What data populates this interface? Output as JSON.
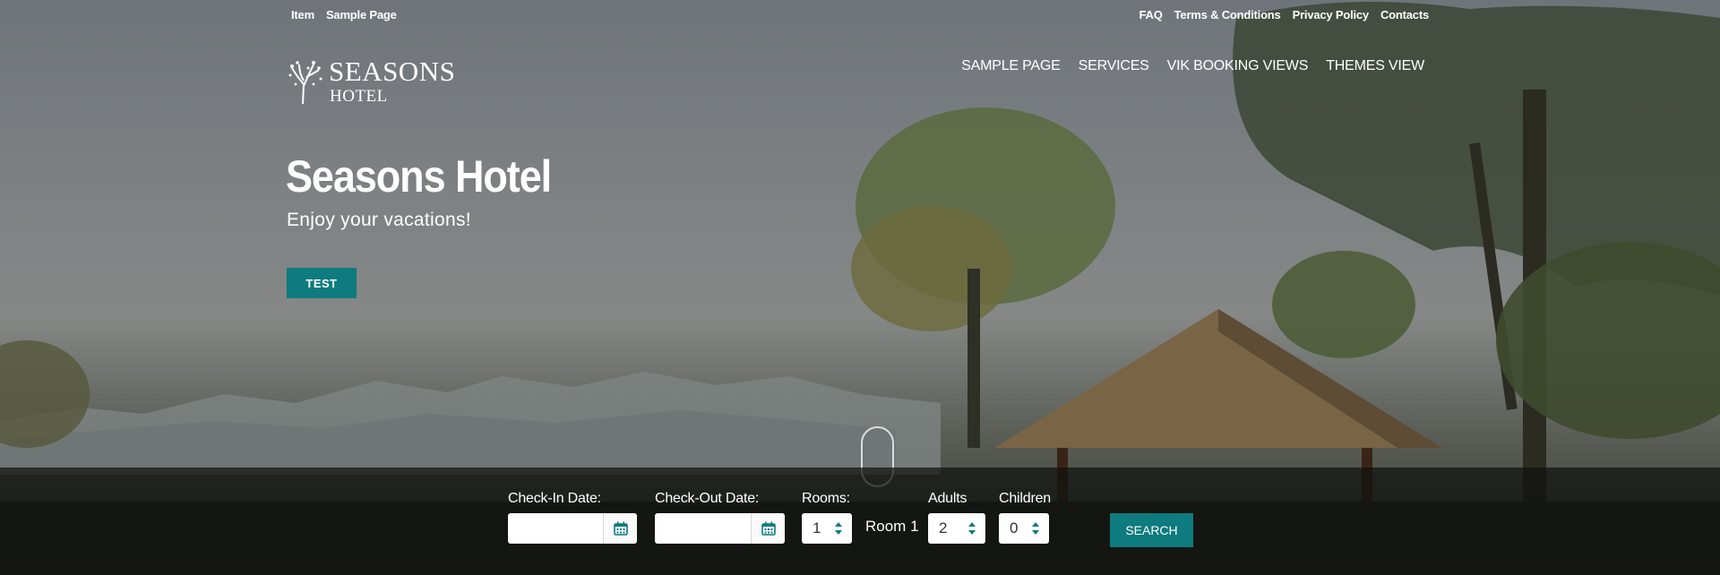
{
  "topbar": {
    "left": [
      "Item",
      "Sample Page"
    ],
    "right": [
      "FAQ",
      "Terms & Conditions",
      "Privacy Policy",
      "Contacts"
    ]
  },
  "logo": {
    "line1": "SEASONS",
    "line2": "HOTEL"
  },
  "nav": [
    "SAMPLE PAGE",
    "SERVICES",
    "VIK BOOKING VIEWS",
    "THEMES VIEW"
  ],
  "hero": {
    "title": "Seasons Hotel",
    "subtitle": "Enjoy your vacations!",
    "button": "TEST"
  },
  "booking": {
    "checkin_label": "Check-In Date:",
    "checkout_label": "Check-Out Date:",
    "checkin_value": "",
    "checkout_value": "",
    "rooms_label": "Rooms:",
    "rooms_value": "1",
    "room_name": "Room 1",
    "adults_label": "Adults",
    "adults_value": "2",
    "children_label": "Children",
    "children_value": "0",
    "search_button": "SEARCH"
  },
  "colors": {
    "accent": "#0e7b7e",
    "booking_bar": "#0f110e"
  },
  "icons": {
    "calendar": "calendar-icon",
    "stepper": "up-down-arrows-icon",
    "logo": "tree-icon",
    "scroll": "scroll-indicator"
  }
}
